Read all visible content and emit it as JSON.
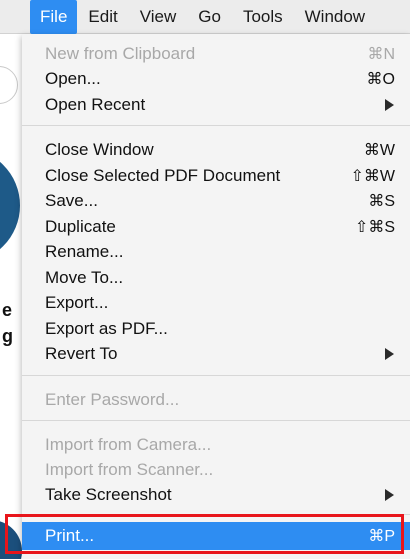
{
  "menubar": {
    "items": [
      "File",
      "Edit",
      "View",
      "Go",
      "Tools",
      "Window"
    ],
    "active": "File"
  },
  "file_menu": {
    "new_from_clipboard": {
      "label": "New from Clipboard",
      "shortcut": "⌘N",
      "enabled": false
    },
    "open": {
      "label": "Open...",
      "shortcut": "⌘O",
      "enabled": true
    },
    "open_recent": {
      "label": "Open Recent",
      "submenu": true,
      "enabled": true
    },
    "close_window": {
      "label": "Close Window",
      "shortcut": "⌘W",
      "enabled": true
    },
    "close_selected_pdf": {
      "label": "Close Selected PDF Document",
      "shortcut": "⇧⌘W",
      "enabled": true
    },
    "save": {
      "label": "Save...",
      "shortcut": "⌘S",
      "enabled": true
    },
    "duplicate": {
      "label": "Duplicate",
      "shortcut": "⇧⌘S",
      "enabled": true
    },
    "rename": {
      "label": "Rename...",
      "enabled": true
    },
    "move_to": {
      "label": "Move To...",
      "enabled": true
    },
    "export": {
      "label": "Export...",
      "enabled": true
    },
    "export_as_pdf": {
      "label": "Export as PDF...",
      "enabled": true
    },
    "revert_to": {
      "label": "Revert To",
      "submenu": true,
      "enabled": true
    },
    "enter_password": {
      "label": "Enter Password...",
      "enabled": false
    },
    "import_from_camera": {
      "label": "Import from Camera...",
      "enabled": false
    },
    "import_from_scanner": {
      "label": "Import from Scanner...",
      "enabled": false
    },
    "take_screenshot": {
      "label": "Take Screenshot",
      "submenu": true,
      "enabled": true
    },
    "print": {
      "label": "Print...",
      "shortcut": "⌘P",
      "enabled": true,
      "highlighted": true
    }
  },
  "colors": {
    "highlight": "#2e8df2",
    "annotation_box": "#e8151b",
    "disabled_text": "#a8a8a8"
  }
}
